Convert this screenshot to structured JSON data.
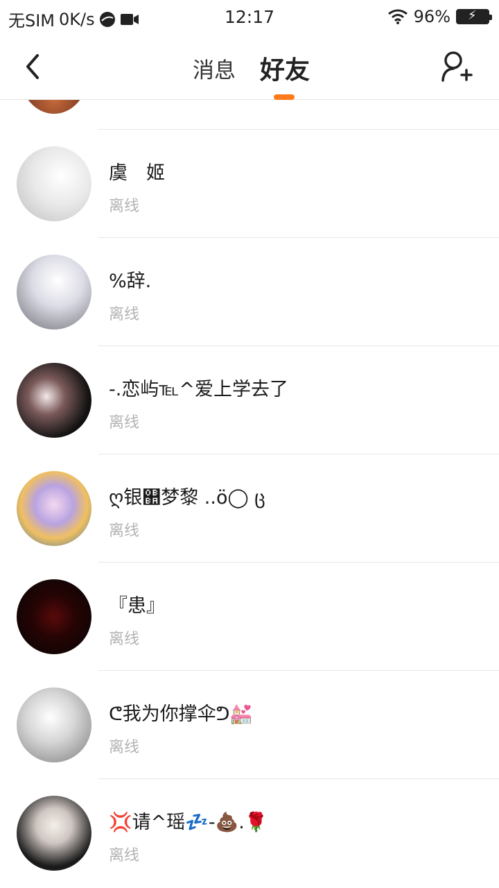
{
  "status_bar": {
    "carrier": "无SIM",
    "speed": "0K/s",
    "time": "12:17",
    "battery": "96%"
  },
  "nav": {
    "tabs": [
      {
        "label": "消息",
        "active": false
      },
      {
        "label": "好友",
        "active": true
      }
    ],
    "accent": "#ff7a1a"
  },
  "friends": [
    {
      "name": "虞　姬",
      "status": "离线"
    },
    {
      "name": "%辞.",
      "status": "离线"
    },
    {
      "name": "-.恋屿℡^爱上学去了",
      "status": "离线"
    },
    {
      "name": "ღ银஺梦黎 ..ö◯ ც",
      "status": "离线"
    },
    {
      "name": "『患』",
      "status": "离线"
    },
    {
      "name": "ᕦ我为你撑伞ᕤ💒",
      "status": "离线"
    },
    {
      "name": "💢请^瑶💤-💩.🌹",
      "status": "离线"
    }
  ]
}
